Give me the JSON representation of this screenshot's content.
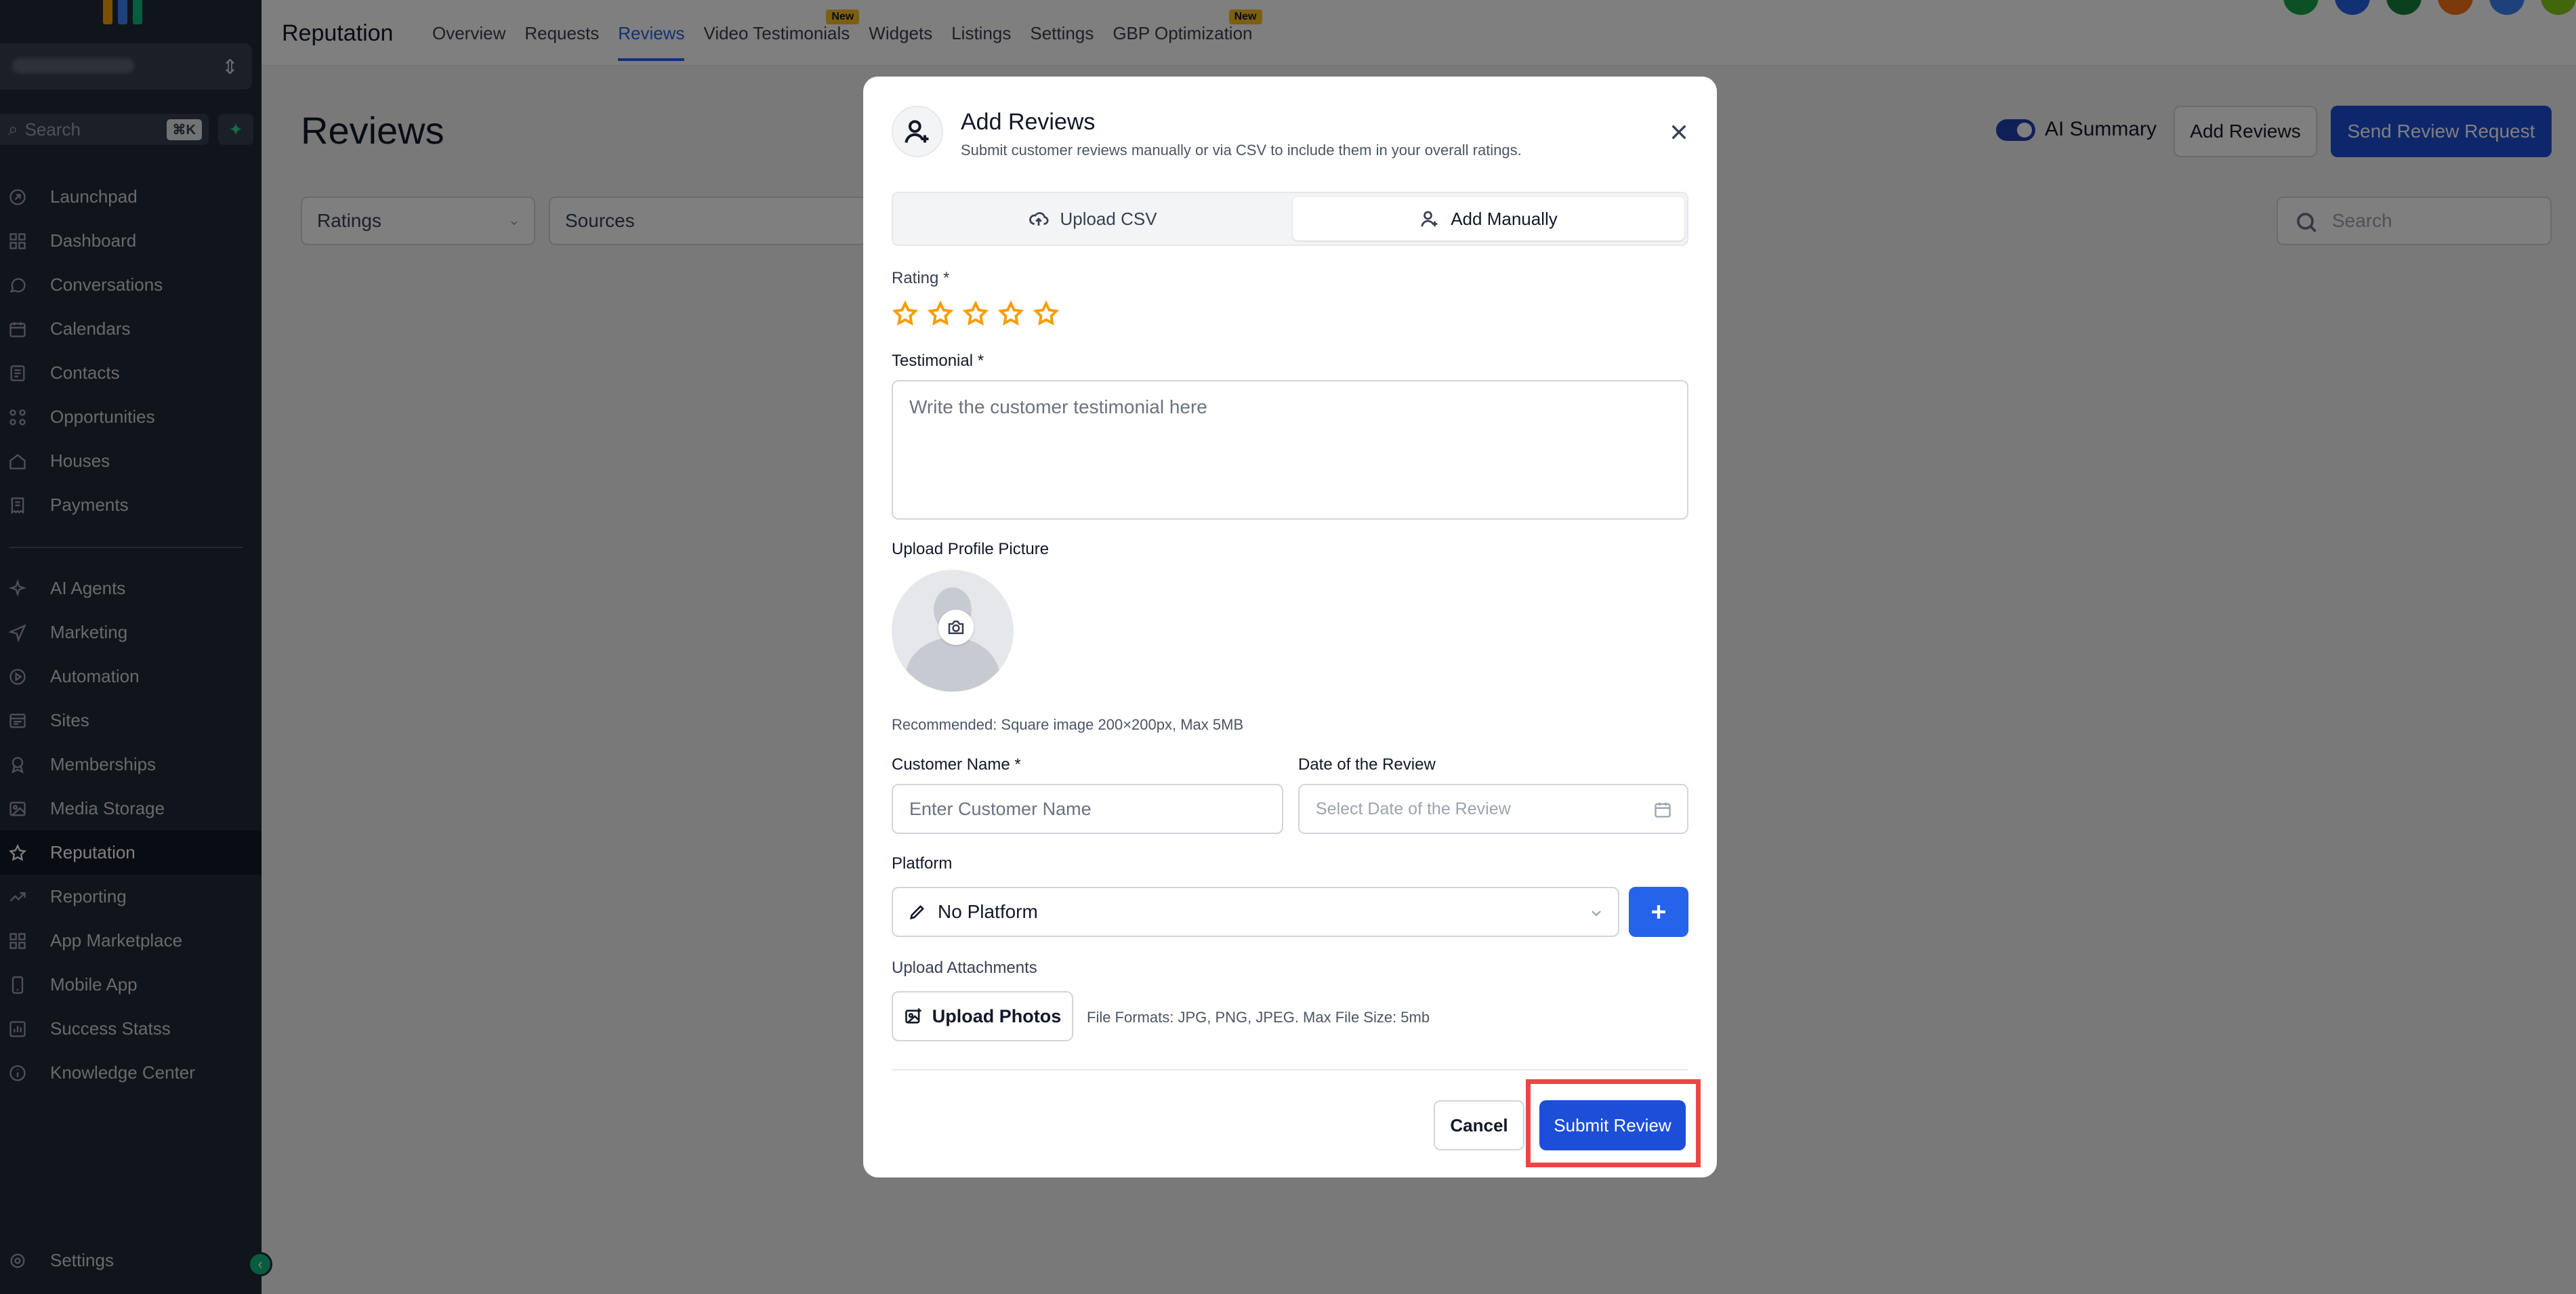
{
  "sidebar": {
    "search_placeholder": "Search",
    "search_shortcut": "⌘K",
    "items": [
      {
        "label": "Launchpad",
        "icon": "rocket-icon"
      },
      {
        "label": "Dashboard",
        "icon": "grid-icon"
      },
      {
        "label": "Conversations",
        "icon": "chat-icon"
      },
      {
        "label": "Calendars",
        "icon": "calendar-icon"
      },
      {
        "label": "Contacts",
        "icon": "contact-card-icon"
      },
      {
        "label": "Opportunities",
        "icon": "opportunities-icon"
      },
      {
        "label": "Houses",
        "icon": "house-icon"
      },
      {
        "label": "Payments",
        "icon": "receipt-icon"
      }
    ],
    "items2": [
      {
        "label": "AI Agents",
        "icon": "sparkles-icon"
      },
      {
        "label": "Marketing",
        "icon": "send-icon"
      },
      {
        "label": "Automation",
        "icon": "automation-icon"
      },
      {
        "label": "Sites",
        "icon": "sites-icon"
      },
      {
        "label": "Memberships",
        "icon": "badge-icon"
      },
      {
        "label": "Media Storage",
        "icon": "image-icon"
      },
      {
        "label": "Reputation",
        "icon": "star-icon",
        "active": true
      },
      {
        "label": "Reporting",
        "icon": "trend-icon"
      },
      {
        "label": "App Marketplace",
        "icon": "apps-icon"
      },
      {
        "label": "Mobile App",
        "icon": "mobile-icon"
      },
      {
        "label": "Success Statss",
        "icon": "chart-icon"
      },
      {
        "label": "Knowledge Center",
        "icon": "info-icon"
      }
    ],
    "settings_label": "Settings"
  },
  "topbar": {
    "title": "Reputation",
    "tabs": [
      {
        "label": "Overview"
      },
      {
        "label": "Requests"
      },
      {
        "label": "Reviews",
        "active": true
      },
      {
        "label": "Video Testimonials",
        "badge": "New"
      },
      {
        "label": "Widgets"
      },
      {
        "label": "Listings"
      },
      {
        "label": "Settings"
      },
      {
        "label": "GBP Optimization",
        "badge": "New"
      }
    ]
  },
  "page": {
    "title": "Reviews",
    "ai_summary_label": "AI Summary",
    "add_reviews_label": "Add Reviews",
    "send_request_label": "Send Review Request",
    "filter_ratings": "Ratings",
    "filter_sources": "Sources",
    "search_placeholder": "Search"
  },
  "modal": {
    "title": "Add Reviews",
    "subtitle": "Submit customer reviews manually or via CSV to include them in your overall ratings.",
    "tab_csv": "Upload CSV",
    "tab_manual": "Add Manually",
    "rating_label": "Rating *",
    "testimonial_label": "Testimonial *",
    "testimonial_placeholder": "Write the customer testimonial here",
    "profile_label": "Upload Profile Picture",
    "profile_hint": "Recommended: Square image 200×200px, Max 5MB",
    "customer_label": "Customer Name *",
    "customer_placeholder": "Enter Customer Name",
    "date_label": "Date of the Review",
    "date_placeholder": "Select Date of the Review",
    "platform_label": "Platform",
    "platform_value": "No Platform",
    "attachments_label": "Upload Attachments",
    "upload_photos_label": "Upload Photos",
    "formats_hint": "File Formats: JPG, PNG, JPEG. Max File Size: 5mb",
    "cancel_label": "Cancel",
    "submit_label": "Submit Review"
  },
  "colors": {
    "primary": "#1d4ed8",
    "sidebar_bg": "#1f2a37",
    "star": "#f59e0b",
    "highlight": "#ef4444"
  }
}
